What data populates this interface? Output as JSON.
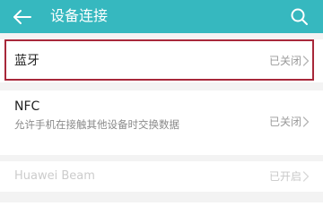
{
  "header": {
    "title": "设备连接",
    "back_icon": "arrow-left-icon",
    "search_icon": "search-icon",
    "background_color": "#36b8bf"
  },
  "settings": {
    "bluetooth": {
      "label": "蓝牙",
      "status": "已关闭",
      "highlighted": true,
      "highlight_color": "#a8283a"
    },
    "nfc": {
      "label": "NFC",
      "description": "允许手机在接触其他设备时交换数据",
      "status": "已关闭"
    },
    "huawei_beam": {
      "label": "Huawei Beam",
      "status": "已开启",
      "disabled": true
    }
  },
  "icons": {
    "chevron": "chevron-right-icon"
  }
}
